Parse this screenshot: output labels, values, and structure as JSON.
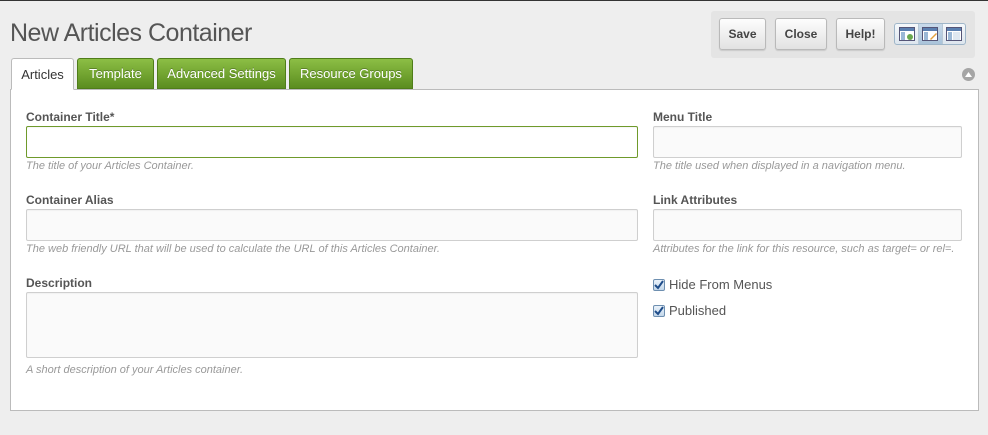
{
  "page": {
    "title": "New Articles Container"
  },
  "toolbar": {
    "save_label": "Save",
    "close_label": "Close",
    "help_label": "Help!",
    "layout_icons": [
      "layout-left-icon",
      "layout-edit-icon",
      "layout-top-icon"
    ]
  },
  "tabs": [
    {
      "label": "Articles",
      "active": true
    },
    {
      "label": "Template",
      "active": false
    },
    {
      "label": "Advanced Settings",
      "active": false
    },
    {
      "label": "Resource Groups",
      "active": false
    }
  ],
  "form": {
    "container_title": {
      "label": "Container Title*",
      "value": "",
      "help": "The title of your Articles Container."
    },
    "container_alias": {
      "label": "Container Alias",
      "value": "",
      "help": "The web friendly URL that will be used to calculate the URL of this Articles Container."
    },
    "description": {
      "label": "Description",
      "value": "",
      "help": "A short description of your Articles container."
    },
    "menu_title": {
      "label": "Menu Title",
      "value": "",
      "help": "The title used when displayed in a navigation menu."
    },
    "link_attributes": {
      "label": "Link Attributes",
      "value": "",
      "help": "Attributes for the link for this resource, such as target= or rel=."
    },
    "hide_from_menus": {
      "label": "Hide From Menus",
      "checked": true
    },
    "published": {
      "label": "Published",
      "checked": true
    }
  },
  "colors": {
    "tab_green": "#6a9c2a",
    "focus_border": "#6f9a2b",
    "checkbox_tick": "#1f4d8a"
  }
}
